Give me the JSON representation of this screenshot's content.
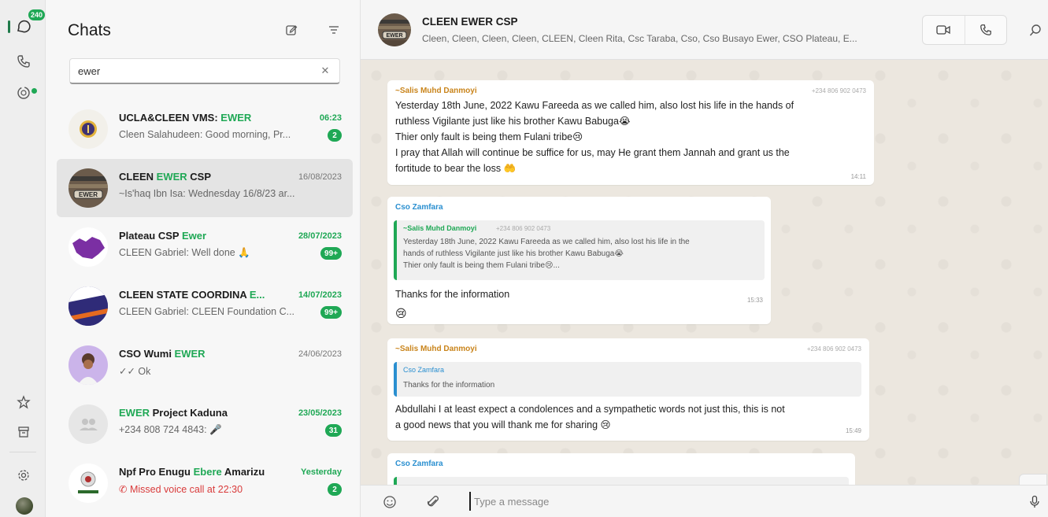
{
  "rail": {
    "chats_badge": "240",
    "icons": [
      "chat-icon",
      "phone-icon",
      "status-icon",
      "star-icon",
      "archive-icon",
      "settings-icon"
    ]
  },
  "list": {
    "title": "Chats",
    "search": {
      "value": "ewer"
    },
    "chats": [
      {
        "name_pre": "UCLA&CLEEN VMS: ",
        "name_hl": "EWER",
        "name_post": "",
        "date": "06:23",
        "unread": true,
        "preview": "Cleen Salahudeen: Good morning, Pr...",
        "badge": "2",
        "selected": false,
        "missed": false
      },
      {
        "name_pre": "CLEEN ",
        "name_hl": "EWER",
        "name_post": " CSP",
        "date": "16/08/2023",
        "unread": false,
        "preview": "~Is'haq Ibn Isa: Wednesday 16/8/23 ar...",
        "badge": "",
        "selected": true,
        "missed": false
      },
      {
        "name_pre": "Plateau CSP ",
        "name_hl": "Ewer",
        "name_post": "",
        "date": "28/07/2023",
        "unread": true,
        "preview": "CLEEN Gabriel: Well done 🙏",
        "badge": "99+",
        "selected": false,
        "missed": false
      },
      {
        "name_pre": "CLEEN STATE COORDINA ",
        "name_hl": "E...",
        "name_post": "",
        "date": "14/07/2023",
        "unread": true,
        "preview": "CLEEN Gabriel: CLEEN Foundation C...",
        "badge": "99+",
        "selected": false,
        "missed": false
      },
      {
        "name_pre": "CSO Wumi ",
        "name_hl": "EWER",
        "name_post": "",
        "date": "24/06/2023",
        "unread": false,
        "preview": "✓✓ Ok",
        "badge": "",
        "selected": false,
        "missed": false
      },
      {
        "name_pre": "",
        "name_hl": "EWER",
        "name_post": " Project Kaduna",
        "date": "23/05/2023",
        "unread": true,
        "preview": "+234 808 724 4843: 🎤",
        "badge": "31",
        "selected": false,
        "missed": false
      },
      {
        "name_pre": "Npf Pro Enugu ",
        "name_hl": "Ebere",
        "name_post": " Amarizu",
        "date": "Yesterday",
        "unread": true,
        "preview": "✆ Missed voice call at 22:30",
        "badge": "2",
        "selected": false,
        "missed": true
      }
    ]
  },
  "conversation": {
    "title": "CLEEN EWER CSP",
    "members": "Cleen, Cleen, Cleen, Cleen, CLEEN, Cleen Rita, Csc Taraba, Cso, Cso Busayo Ewer, CSO Plateau, E...",
    "messages": {
      "m1": {
        "sender": "~Salis Muhd Danmoyi",
        "phone": "+234 806 902 0473",
        "lines": [
          "Yesterday 18th June, 2022 Kawu Fareeda as we called him, also lost his life in the hands of",
          "ruthless Vigilante just like his brother Kawu Babuga😭",
          "Thier only fault is being them Fulani tribe😢",
          "I pray that Allah will continue be suffice for us, may He grant them Jannah and grant us the",
          "fortitude to bear the loss 🤲"
        ],
        "time": "14:11"
      },
      "m2": {
        "sender": "Cso Zamfara",
        "quote_sender": "~Salis Muhd Danmoyi",
        "quote_phone": "+234 806 902 0473",
        "quote_lines": [
          "Yesterday 18th June, 2022 Kawu Fareeda as we called him, also lost his life in the",
          "hands of ruthless Vigilante just like his brother Kawu Babuga😭",
          "Thier only fault is being them Fulani tribe😢..."
        ],
        "text": "Thanks for the information",
        "time": "15:33",
        "reaction": "😢"
      },
      "m3": {
        "sender": "~Salis Muhd Danmoyi",
        "phone": "+234 806 902 0473",
        "quote_sender": "Cso Zamfara",
        "quote_text": "Thanks for the information",
        "lines": [
          "Abdullahi I at least expect a condolences and a sympathetic words not just this, this is not",
          "a good news that you will thank me for sharing 😢"
        ],
        "time": "15:49"
      },
      "m4": {
        "sender": "Cso Zamfara"
      }
    },
    "composer": {
      "placeholder": "Type a message"
    }
  }
}
